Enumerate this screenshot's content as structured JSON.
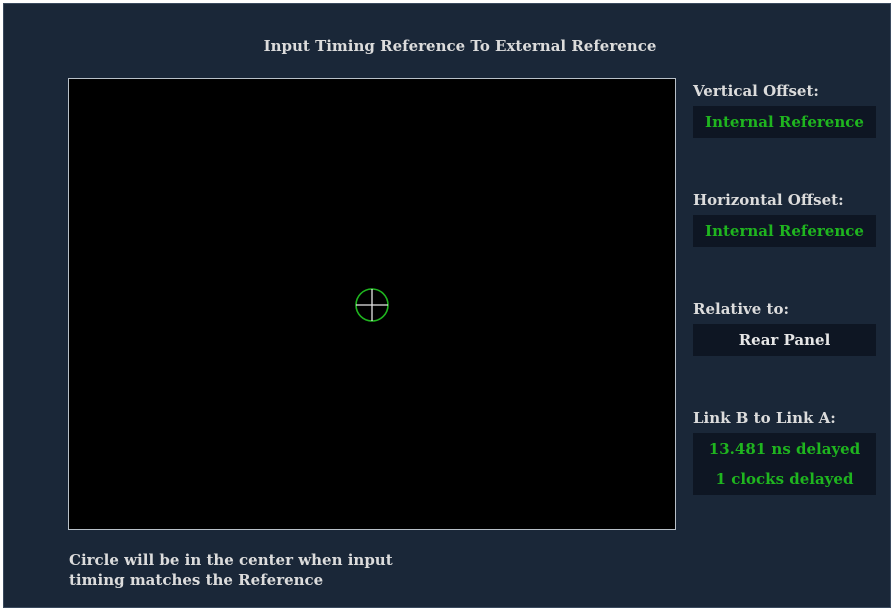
{
  "title": "Input Timing Reference To External Reference",
  "vertical_offset": {
    "label": "Vertical Offset:",
    "value": "Internal Reference"
  },
  "horizontal_offset": {
    "label": "Horizontal Offset:",
    "value": "Internal Reference"
  },
  "relative_to": {
    "label": "Relative to:",
    "value": "Rear Panel"
  },
  "link_b_to_a": {
    "label": "Link B to Link A:",
    "ns_value": "13.481 ns delayed",
    "clocks_value": "1 clocks delayed"
  },
  "note": {
    "line1": "Circle will be in the center when input",
    "line2": "timing matches the Reference"
  },
  "colors": {
    "background": "#1a2738",
    "display": "#000000",
    "accent_green": "#1fb51f",
    "value_box": "#0e1623"
  },
  "icons": {
    "target": "crosshair-circle-icon"
  }
}
